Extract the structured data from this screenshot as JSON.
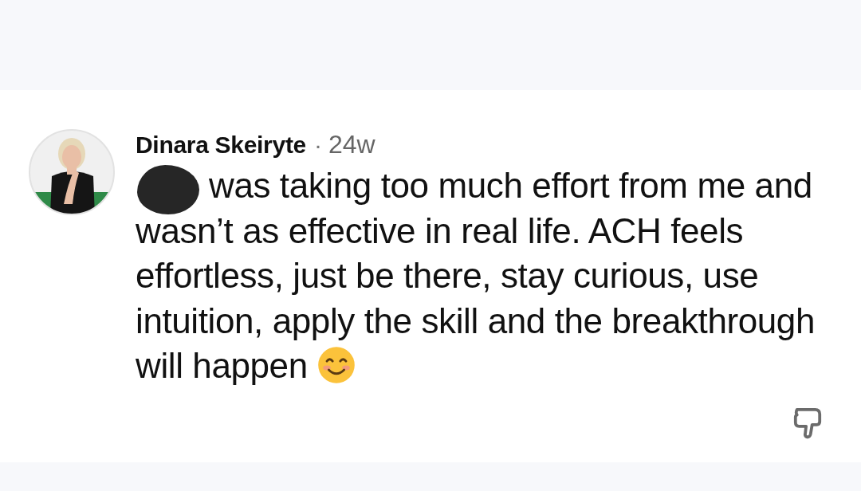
{
  "comment": {
    "author": "Dinara Skeiryte",
    "separator": "·",
    "age": "24w",
    "redacted": true,
    "text": "was taking too much effort from me and wasn’t as effective in real life. ACH feels effortless, just be there, stay curious, use intuition, apply the skill and the breakthrough will happen"
  }
}
